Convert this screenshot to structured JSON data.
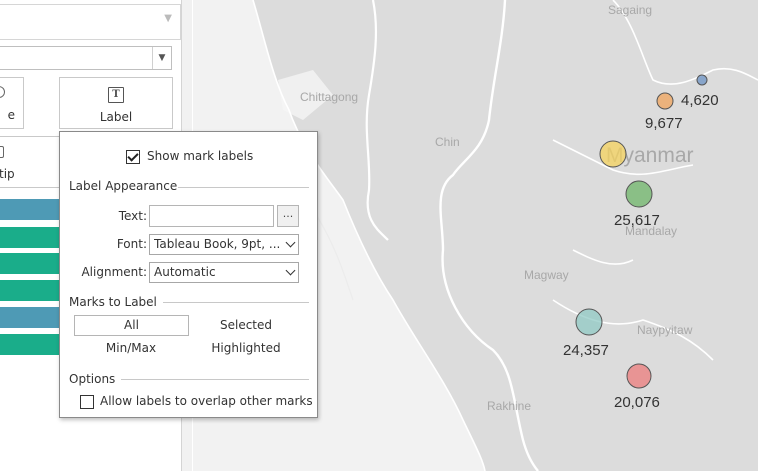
{
  "left_panel": {
    "marks_cards": {
      "size_label": "e",
      "label_label": "Label",
      "tooltip_label": "tip"
    },
    "pill_colors": [
      "#4e9ab5",
      "#1aad8a",
      "#1aad8a",
      "#1aad8a",
      "#4e9ab5",
      "#1aad8a"
    ]
  },
  "label_popup": {
    "show_mark_labels": "Show mark labels",
    "show_mark_labels_checked": true,
    "label_appearance": {
      "title": "Label Appearance",
      "text_label": "Text:",
      "text_button": "...",
      "font_label": "Font:",
      "font_value": "Tableau Book, 9pt, ...",
      "alignment_label": "Alignment:",
      "alignment_value": "Automatic"
    },
    "marks_to_label": {
      "title": "Marks to Label",
      "all": "All",
      "selected": "Selected",
      "min_max": "Min/Max",
      "highlighted": "Highlighted"
    },
    "options": {
      "title": "Options",
      "allow_overlap": "Allow labels to overlap other marks",
      "allow_overlap_checked": false
    }
  },
  "map": {
    "places": {
      "sagaing": "Sagaing",
      "chittagong": "Chittagong",
      "chin": "Chin",
      "myanmar": "Myanmar",
      "mandalay": "Mandalay",
      "magway": "Magway",
      "naypyitaw": "Naypyitaw",
      "rakhine": "Rakhine"
    },
    "marks": [
      {
        "label": "4,620",
        "color": "#6c93c4"
      },
      {
        "label": "9,677",
        "color": "#f0a45c"
      },
      {
        "label": "",
        "color": "#f5d35e"
      },
      {
        "label": "25,617",
        "color": "#6fb56a"
      },
      {
        "label": "24,357",
        "color": "#90c9c4"
      },
      {
        "label": "20,076",
        "color": "#ec7c7c"
      }
    ]
  }
}
